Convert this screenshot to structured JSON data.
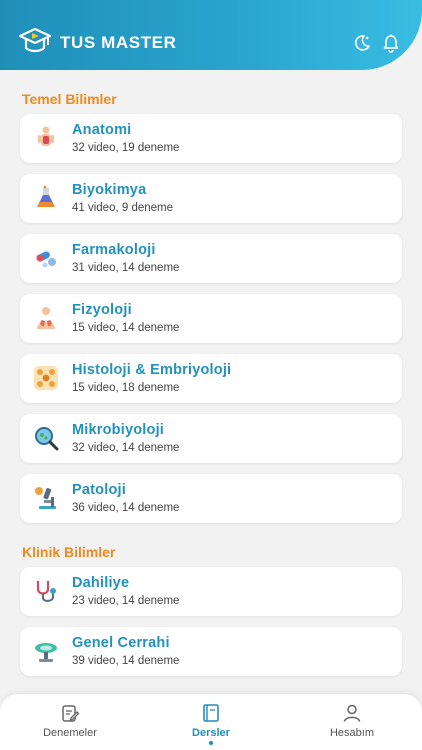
{
  "header": {
    "title": "TUS MASTER"
  },
  "sections": [
    {
      "title": "Temel Bilimler",
      "items": [
        {
          "name": "Anatomi",
          "meta": "32 video, 19 deneme",
          "icon": "anatomy-body-icon"
        },
        {
          "name": "Biyokimya",
          "meta": "41 video, 9 deneme",
          "icon": "flask-icon"
        },
        {
          "name": "Farmakoloji",
          "meta": "31 video, 14 deneme",
          "icon": "pills-icon"
        },
        {
          "name": "Fizyoloji",
          "meta": "15 video, 14 deneme",
          "icon": "lungs-body-icon"
        },
        {
          "name": "Histoloji & Embriyoloji",
          "meta": "15 video, 18 deneme",
          "icon": "cells-icon"
        },
        {
          "name": "Mikrobiyoloji",
          "meta": "32 video, 14 deneme",
          "icon": "magnifier-bacteria-icon"
        },
        {
          "name": "Patoloji",
          "meta": "36 video, 14 deneme",
          "icon": "microscope-icon"
        }
      ]
    },
    {
      "title": "Klinik Bilimler",
      "items": [
        {
          "name": "Dahiliye",
          "meta": "23 video, 14 deneme",
          "icon": "stethoscope-icon"
        },
        {
          "name": "Genel Cerrahi",
          "meta": "39 video, 14 deneme",
          "icon": "surgery-lamp-icon"
        }
      ]
    }
  ],
  "tabs": [
    {
      "label": "Denemeler",
      "icon": "exam-icon",
      "active": false
    },
    {
      "label": "Dersler",
      "icon": "book-icon",
      "active": true
    },
    {
      "label": "Hesabım",
      "icon": "user-icon",
      "active": false
    }
  ],
  "colors": {
    "primary": "#1f8fb8",
    "accent": "#ee8a1e",
    "background": "#f2f2f2"
  }
}
